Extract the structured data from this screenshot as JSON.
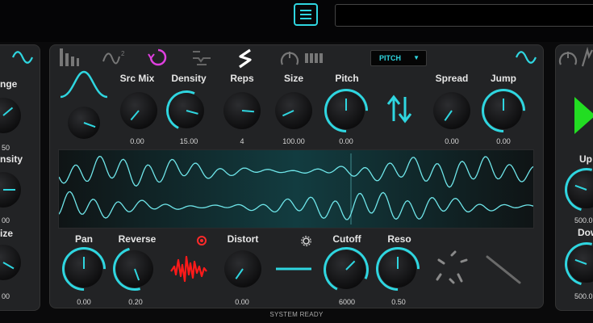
{
  "header": {
    "menu_icon": "list-icon",
    "display_text": ""
  },
  "left_panel": {
    "labels": [
      "nge",
      "nsity",
      "ize"
    ],
    "values": [
      "50",
      "00",
      "00"
    ]
  },
  "main_panel": {
    "icons": [
      "bars-icon",
      "wave-squared-icon",
      "loop-icon",
      "flat-wave-icon",
      "s-curve-icon",
      "knob-bars-icon",
      "sine-icon"
    ],
    "pitch_select": {
      "value": "PITCH"
    },
    "row1": {
      "labels": {
        "src_mix": "Src Mix",
        "density": "Density",
        "reps": "Reps",
        "size": "Size",
        "pitch": "Pitch",
        "spread": "Spread",
        "jump": "Jump"
      },
      "values": {
        "src_mix": "0.00",
        "density": "15.00",
        "reps": "4",
        "size": "100.00",
        "pitch": "0.00",
        "spread": "0.00",
        "jump": "0.00"
      }
    },
    "row2": {
      "labels": {
        "pan": "Pan",
        "reverse": "Reverse",
        "distort": "Distort",
        "cutoff": "Cutoff",
        "reso": "Reso"
      },
      "values": {
        "pan": "0.00",
        "reverse": "0.20",
        "distort": "0.00",
        "cutoff": "6000",
        "reso": "0.50"
      }
    }
  },
  "right_panel": {
    "labels": [
      "Up",
      "Dow"
    ],
    "values": [
      "500.0",
      "500.0"
    ]
  },
  "status": "SYSTEM READY",
  "colors": {
    "accent": "#2fd6e0",
    "magenta": "#e040e0",
    "red": "#ff1a1a",
    "green": "#22dd22",
    "panel": "#222325"
  }
}
